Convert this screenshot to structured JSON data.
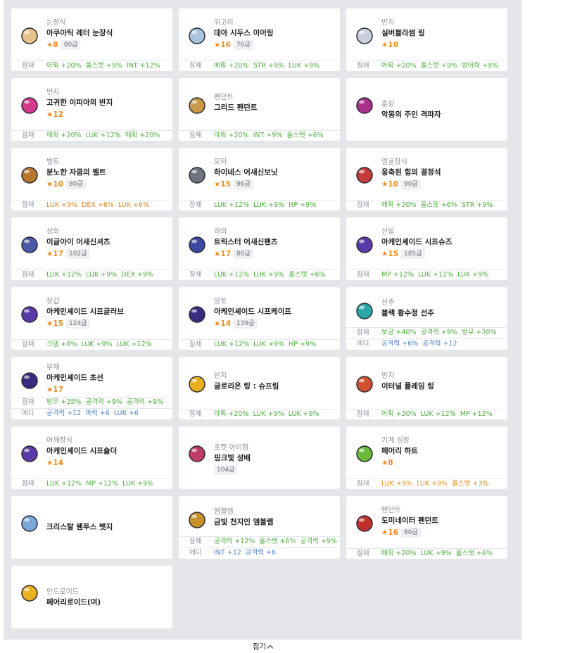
{
  "colors": {
    "star": "#f08c1e",
    "green": "#4eae3e",
    "orange": "#e08a1e",
    "blue": "#4a7fc9"
  },
  "labels": {
    "potential": "잠재",
    "additional": "에디"
  },
  "collapse": {
    "label": "접기"
  },
  "items": [
    {
      "type": "눈장식",
      "name": "아쿠아틱 레터 눈장식",
      "star": "★8",
      "level": "80급",
      "icon": "face-accessory-icon",
      "color": "#e8c48a",
      "potential": [
        {
          "text": "아획 +20%",
          "c": "green"
        },
        {
          "text": "올스탯 +9%",
          "c": "green"
        },
        {
          "text": "INT +12%",
          "c": "green"
        }
      ]
    },
    {
      "type": "귀고리",
      "name": "데아 시두스 이어링",
      "star": "★16",
      "level": "70급",
      "icon": "earring-icon",
      "color": "#a8c4e0",
      "potential": [
        {
          "text": "메획 +20%",
          "c": "green"
        },
        {
          "text": "STR +9%",
          "c": "green"
        },
        {
          "text": "LUK +9%",
          "c": "green"
        }
      ]
    },
    {
      "type": "반지",
      "name": "실버블라썸 링",
      "star": "★10",
      "level": "",
      "icon": "ring-icon",
      "color": "#c9cfdc",
      "potential": [
        {
          "text": "아획 +20%",
          "c": "green"
        },
        {
          "text": "올스탯 +9%",
          "c": "green"
        },
        {
          "text": "방어력 +9%",
          "c": "green"
        }
      ]
    },
    {
      "type": "반지",
      "name": "고귀한 이피아의 반지",
      "star": "★12",
      "level": "",
      "icon": "ring-icon",
      "color": "#d33a8c",
      "potential": [
        {
          "text": "메획 +20%",
          "c": "green"
        },
        {
          "text": "LUK +12%",
          "c": "green"
        },
        {
          "text": "메획 +20%",
          "c": "green"
        }
      ]
    },
    {
      "type": "펜던트",
      "name": "그리드 펜던트",
      "star": "",
      "level": "",
      "icon": "pendant-icon",
      "color": "#c89a4a",
      "potential": [
        {
          "text": "아획 +20%",
          "c": "green"
        },
        {
          "text": "INT +9%",
          "c": "green"
        },
        {
          "text": "올스탯 +6%",
          "c": "green"
        }
      ]
    },
    {
      "type": "훈장",
      "name": "악몽의 주인 격파자",
      "star": "",
      "level": "",
      "icon": "medal-icon",
      "color": "#a8308a",
      "potential": []
    },
    {
      "type": "벨트",
      "name": "분노한 자쿰의 벨트",
      "star": "★10",
      "level": "80급",
      "icon": "belt-icon",
      "color": "#b5772b",
      "potential": [
        {
          "text": "LUK +9%",
          "c": "orange"
        },
        {
          "text": "DEX +6%",
          "c": "orange"
        },
        {
          "text": "LUK +6%",
          "c": "orange"
        }
      ]
    },
    {
      "type": "모자",
      "name": "하이네스 어새신보닛",
      "star": "★15",
      "level": "96급",
      "icon": "hat-icon",
      "color": "#707480",
      "potential": [
        {
          "text": "LUK +12%",
          "c": "green"
        },
        {
          "text": "LUK +9%",
          "c": "green"
        },
        {
          "text": "HP +9%",
          "c": "green"
        }
      ]
    },
    {
      "type": "얼굴장식",
      "name": "응축된 힘의 결정석",
      "star": "★10",
      "level": "90급",
      "icon": "face-crystal-icon",
      "color": "#c23b3b",
      "potential": [
        {
          "text": "메획 +20%",
          "c": "green"
        },
        {
          "text": "올스탯 +6%",
          "c": "green"
        },
        {
          "text": "STR +9%",
          "c": "green"
        }
      ]
    },
    {
      "type": "상의",
      "name": "이글아이 어새신셔츠",
      "star": "★17",
      "level": "102급",
      "icon": "shirt-icon",
      "color": "#4a5aa8",
      "potential": [
        {
          "text": "LUK +12%",
          "c": "green"
        },
        {
          "text": "LUK +9%",
          "c": "green"
        },
        {
          "text": "DEX +9%",
          "c": "green"
        }
      ]
    },
    {
      "type": "하의",
      "name": "트릭스터 어새신팬츠",
      "star": "★17",
      "level": "80급",
      "icon": "pants-icon",
      "color": "#3b4aa0",
      "potential": [
        {
          "text": "LUK +12%",
          "c": "green"
        },
        {
          "text": "LUK +9%",
          "c": "green"
        },
        {
          "text": "올스탯 +6%",
          "c": "green"
        }
      ]
    },
    {
      "type": "신발",
      "name": "아케인셰이드 시프슈즈",
      "star": "★15",
      "level": "185급",
      "icon": "shoes-icon",
      "color": "#5a3aa8",
      "potential": [
        {
          "text": "MP +12%",
          "c": "green"
        },
        {
          "text": "LUK +12%",
          "c": "green"
        },
        {
          "text": "LUK +9%",
          "c": "green"
        }
      ]
    },
    {
      "type": "장갑",
      "name": "아케인셰이드 시프글러브",
      "star": "★15",
      "level": "124급",
      "icon": "glove-icon",
      "color": "#5a3aa8",
      "potential": [
        {
          "text": "크뎀 +8%",
          "c": "green"
        },
        {
          "text": "LUK +9%",
          "c": "green"
        },
        {
          "text": "LUK +12%",
          "c": "green"
        }
      ]
    },
    {
      "type": "망토",
      "name": "아케인셰이드 시프케이프",
      "star": "★14",
      "level": "139급",
      "icon": "cape-icon",
      "color": "#3a2a80",
      "potential": [
        {
          "text": "LUK +12%",
          "c": "green"
        },
        {
          "text": "LUK +9%",
          "c": "green"
        },
        {
          "text": "HP +9%",
          "c": "green"
        }
      ]
    },
    {
      "type": "선추",
      "name": "블랙 황수정 선추",
      "star": "",
      "level": "",
      "icon": "pocket-charm-icon",
      "color": "#2aa8a8",
      "potential": [
        {
          "text": "보공 +40%",
          "c": "green"
        },
        {
          "text": "공격력 +9%",
          "c": "green"
        },
        {
          "text": "방무 +30%",
          "c": "green"
        }
      ],
      "additional": [
        {
          "text": "공격력 +6%",
          "c": "blue"
        },
        {
          "text": "공격력 +12",
          "c": "blue"
        }
      ]
    },
    {
      "type": "부채",
      "name": "아케인셰이드 초선",
      "star": "★17",
      "level": "",
      "icon": "fan-icon",
      "color": "#3a2a80",
      "potential": [
        {
          "text": "방무 +35%",
          "c": "green"
        },
        {
          "text": "공격력 +9%",
          "c": "green"
        },
        {
          "text": "공격력 +9%",
          "c": "green"
        }
      ],
      "additional": [
        {
          "text": "공격력 +12",
          "c": "blue"
        },
        {
          "text": "마력 +6",
          "c": "blue"
        },
        {
          "text": "LUK +6",
          "c": "blue"
        }
      ]
    },
    {
      "type": "반지",
      "name": "글로리온 링 : 슈프림",
      "star": "",
      "level": "",
      "icon": "ring-icon",
      "color": "#e8b020",
      "potential": [
        {
          "text": "아획 +20%",
          "c": "green"
        },
        {
          "text": "LUK +9%",
          "c": "green"
        },
        {
          "text": "LUK +9%",
          "c": "green"
        }
      ]
    },
    {
      "type": "반지",
      "name": "이터널 플레임 링",
      "star": "",
      "level": "",
      "icon": "ring-icon",
      "color": "#d05030",
      "potential": [
        {
          "text": "아획 +20%",
          "c": "green"
        },
        {
          "text": "LUK +12%",
          "c": "green"
        },
        {
          "text": "MP +12%",
          "c": "green"
        }
      ]
    },
    {
      "type": "어깨장식",
      "name": "아케인셰이드 시프숄더",
      "star": "★14",
      "level": "",
      "icon": "shoulder-icon",
      "color": "#5a3aa8",
      "potential": [
        {
          "text": "LUK +12%",
          "c": "green"
        },
        {
          "text": "MP +12%",
          "c": "green"
        },
        {
          "text": "LUK +9%",
          "c": "green"
        }
      ]
    },
    {
      "type": "포켓 아이템",
      "name": "핑크빛 성배",
      "star": "",
      "level": "104급",
      "icon": "chalice-icon",
      "color": "#c03a6a",
      "potential": []
    },
    {
      "type": "기계 심장",
      "name": "페어리 하트",
      "star": "★8",
      "level": "",
      "icon": "heart-icon",
      "color": "#6ab83a",
      "potential": [
        {
          "text": "LUK +9%",
          "c": "orange"
        },
        {
          "text": "LUK +9%",
          "c": "orange"
        },
        {
          "text": "올스탯 +3%",
          "c": "orange"
        }
      ]
    },
    {
      "type": "",
      "name": "크리스탈 웬투스 뱃지",
      "star": "",
      "level": "",
      "icon": "badge-icon",
      "color": "#7aa8d8",
      "potential": []
    },
    {
      "type": "엠블렘",
      "name": "금빛 천지인 엠블렘",
      "star": "",
      "level": "",
      "icon": "emblem-icon",
      "color": "#c8902a",
      "potential": [
        {
          "text": "공격력 +12%",
          "c": "green"
        },
        {
          "text": "올스탯 +6%",
          "c": "green"
        },
        {
          "text": "공격력 +9%",
          "c": "green"
        }
      ],
      "additional": [
        {
          "text": "INT +12",
          "c": "blue"
        },
        {
          "text": "공격력 +6",
          "c": "blue"
        }
      ]
    },
    {
      "type": "펜던트",
      "name": "도미네이터 펜던트",
      "star": "★16",
      "level": "80급",
      "icon": "pendant-icon",
      "color": "#c0302a",
      "potential": [
        {
          "text": "메획 +20%",
          "c": "green"
        },
        {
          "text": "LUK +9%",
          "c": "green"
        },
        {
          "text": "올스탯 +6%",
          "c": "green"
        }
      ]
    },
    {
      "type": "안드로이드",
      "name": "페어리로이드(여)",
      "star": "",
      "level": "",
      "icon": "android-icon",
      "color": "#e8b020",
      "potential": []
    }
  ]
}
